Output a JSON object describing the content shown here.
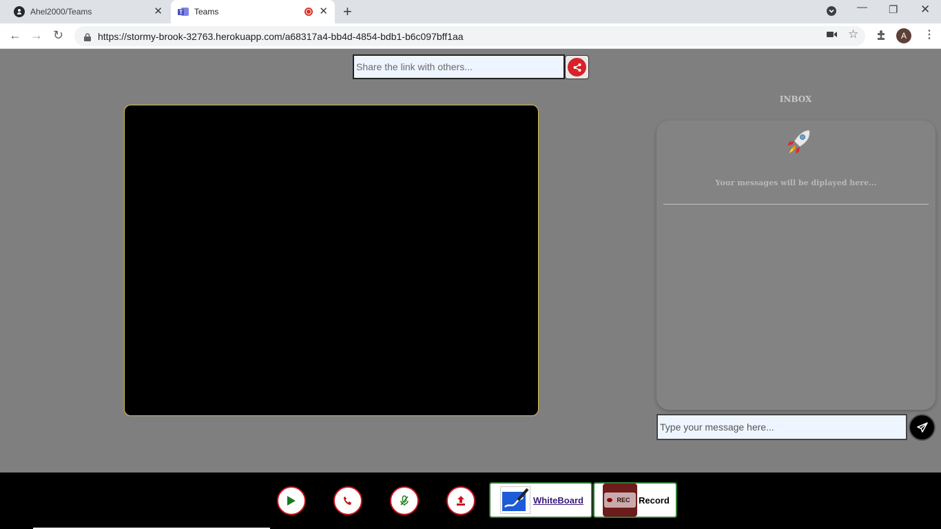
{
  "browser": {
    "tabs": [
      {
        "title": "Ahel2000/Teams",
        "icon": "github-icon"
      },
      {
        "title": "Teams",
        "icon": "teams-icon",
        "recording": true
      }
    ],
    "url": "https://stormy-brook-32763.herokuapp.com/a68317a4-bb4d-4854-bdb1-b6c097bff1aa",
    "profile_initial": "A"
  },
  "share": {
    "placeholder": "Share the link with others...",
    "icon": "share-icon"
  },
  "inbox": {
    "title": "INBOX",
    "icon": "rocket-icon",
    "empty_message": "Your messages will be diplayed here...",
    "input_placeholder": "Type your message here...",
    "send_icon": "send-icon"
  },
  "controls": {
    "play_icon": "play-icon",
    "call_icon": "phone-icon",
    "mic_icon": "mic-off-icon",
    "screen_share_icon": "upload-icon",
    "whiteboard_label": "WhiteBoard",
    "record_label": "Record",
    "record_badge": "REC"
  },
  "colors": {
    "page_bg": "#7f7f7f",
    "accent_red": "#c8141c",
    "accent_green": "#2e7d32",
    "video_border": "#d8c246"
  }
}
